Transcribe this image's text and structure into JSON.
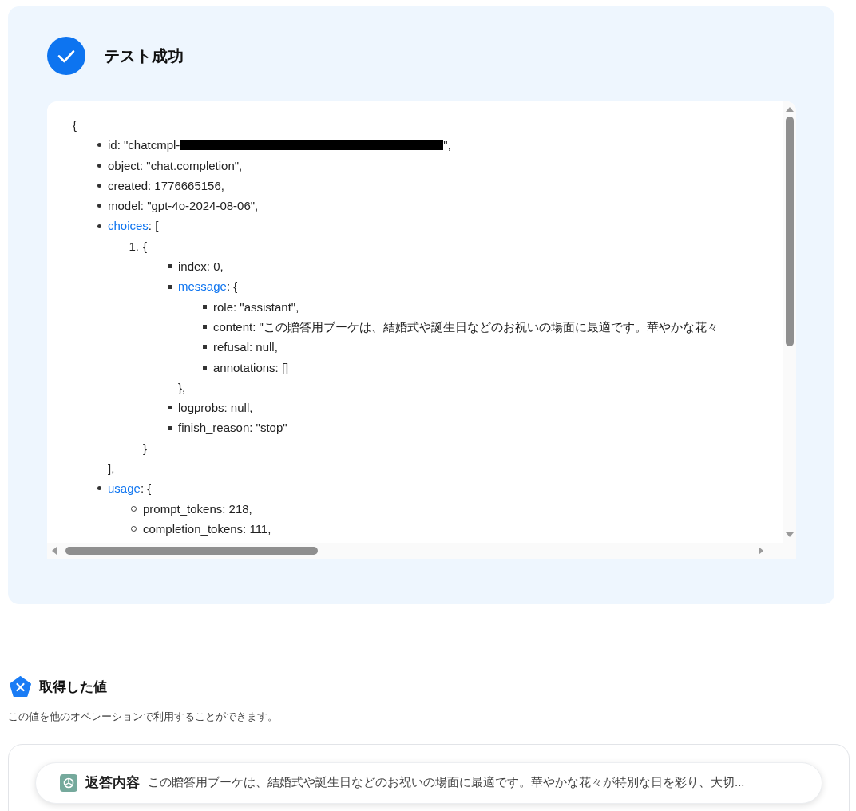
{
  "result": {
    "success": true,
    "title": "テスト成功"
  },
  "json_view": {
    "open": "{",
    "list": {
      "items": [
        {
          "kind": "redacted",
          "text": "id: \"chatcmpl-",
          "after": "\","
        },
        {
          "kind": "plain",
          "text": "object: \"chat.completion\","
        },
        {
          "kind": "plain",
          "text": "created: 1776665156,"
        },
        {
          "kind": "plain",
          "text": "model: \"gpt-4o-2024-08-06\","
        },
        {
          "kind": "link",
          "key": "choices",
          "text": ": [",
          "close": "],",
          "list": {
            "items": [
              {
                "kind": "plain",
                "number": "1.",
                "text": "{",
                "close": "}",
                "list": {
                  "items": [
                    {
                      "kind": "plain",
                      "text": "index: 0,"
                    },
                    {
                      "kind": "link",
                      "key": "message",
                      "text": ": {",
                      "close": "},",
                      "list": {
                        "items": [
                          {
                            "kind": "plain",
                            "text": "role: \"assistant\","
                          },
                          {
                            "kind": "plain",
                            "text": "content: \"この贈答用ブーケは、結婚式や誕生日などのお祝いの場面に最適です。華やかな花々"
                          },
                          {
                            "kind": "plain",
                            "text": "refusal: null,"
                          },
                          {
                            "kind": "plain",
                            "text": "annotations: []"
                          }
                        ]
                      }
                    },
                    {
                      "kind": "plain",
                      "text": "logprobs: null,"
                    },
                    {
                      "kind": "plain",
                      "text": "finish_reason: \"stop\""
                    }
                  ]
                }
              }
            ]
          }
        },
        {
          "kind": "link",
          "key": "usage",
          "text": ": {",
          "list": {
            "items": [
              {
                "kind": "plain",
                "text": "prompt_tokens: 218,"
              },
              {
                "kind": "plain",
                "text": "completion_tokens: 111,"
              }
            ]
          }
        }
      ]
    }
  },
  "values_section": {
    "title": "取得した値",
    "description": "この値を他のオペレーションで利用することができます。",
    "values": [
      {
        "label": "返答内容",
        "value": "この贈答用ブーケは、結婚式や誕生日などのお祝いの場面に最適です。華やかな花々が特別な日を彩り、大切..."
      }
    ]
  }
}
